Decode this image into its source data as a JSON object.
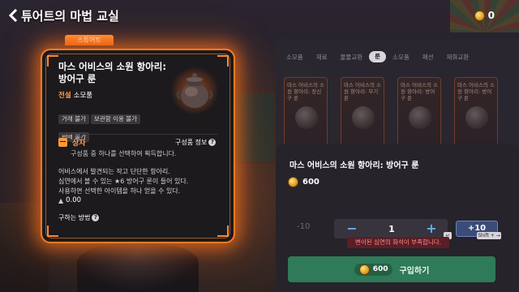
{
  "header": {
    "back_icon": "chevron-left-icon",
    "title": "튜어트의 마법 교실",
    "currency_icon": "coin-icon",
    "currency_amount": "0"
  },
  "item_card": {
    "tag": "스튜어트",
    "name": "마스 어비스의 소원 항아리: 방어구 룬",
    "grade": "전설",
    "category": "소모품",
    "chips": [
      "거래 불가",
      "보관함 이용 불가",
      "판매 불가"
    ],
    "box_title": "상자",
    "box_info_link": "구성품 정보",
    "box_desc": "구성품 중 하나를 선택하여 획득합니다.",
    "desc_lines": [
      "어비스에서 발견되는 작고 단단한 항아리.",
      "심연에서 볼 수 있는 ★6 방어구 룬이 들어 있다.",
      "사용하면 선택한 아이템을 하나 얻을 수 있다."
    ],
    "price_symbol": "▲",
    "price": "0.00",
    "how_to_get": "구하는 방법",
    "accent_color": "#ff7a1e"
  },
  "shop": {
    "tabs": [
      "소모품",
      "재료",
      "물물교환",
      "룬",
      "소모품",
      "패션",
      "재화교환"
    ],
    "active_tab_index": 3,
    "items": [
      "마스 어비스의 소원 항아리: 장신구 룬",
      "마스 어비스의 소원 항아리: 무기 룬",
      "마스 어비스의 소원 항아리: 방어구 룬",
      "마스 어비스의 소원 항아리: 방어구 룬"
    ]
  },
  "purchase": {
    "title": "마스 어비스의 소원 항아리: 방어구 룬",
    "unit_price": "600",
    "minus10_label": "-10",
    "minus_label": "−",
    "quantity": "1",
    "plus_label": "+",
    "plus10_label": "+10",
    "enter_key": "↵",
    "shift_key": "Shift + →",
    "warning": "변이된 심연의 화석이 부족합니다.",
    "total_price": "600",
    "buy_label": "구입하기",
    "buy_color": "#2f7a58"
  }
}
